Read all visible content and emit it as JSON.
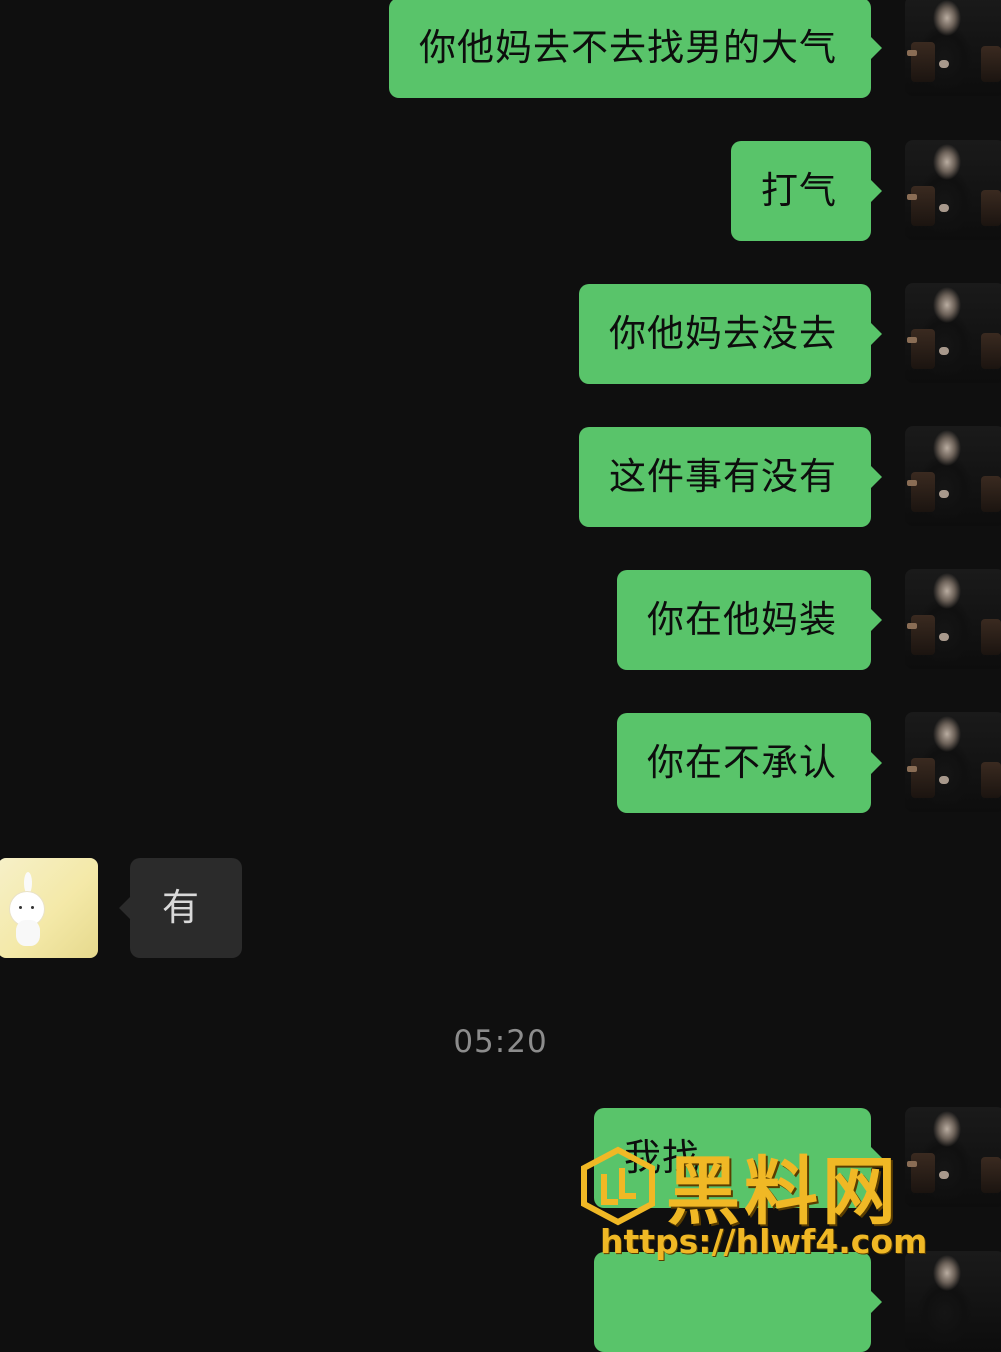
{
  "chat": {
    "messages": [
      {
        "sender": "me",
        "text": "你他妈去不去找男的大气"
      },
      {
        "sender": "me",
        "text": "打气"
      },
      {
        "sender": "me",
        "text": "你他妈去没去"
      },
      {
        "sender": "me",
        "text": "这件事有没有"
      },
      {
        "sender": "me",
        "text": "你在他妈装"
      },
      {
        "sender": "me",
        "text": "你在不承认"
      },
      {
        "sender": "them",
        "text": "有"
      },
      {
        "sender": "me",
        "text": "我找"
      }
    ],
    "timestamp": "05:20"
  },
  "colors": {
    "background": "#0f0f0f",
    "my_bubble": "#59c46a",
    "their_bubble": "#2b2b2b",
    "watermark": "#f0b825"
  },
  "icons": {
    "my_avatar": "person-in-armchair-photo",
    "their_avatar": "white-bunny-on-yellow"
  },
  "watermark": {
    "title": "黑料网",
    "url": "https://hlwf4.com"
  }
}
